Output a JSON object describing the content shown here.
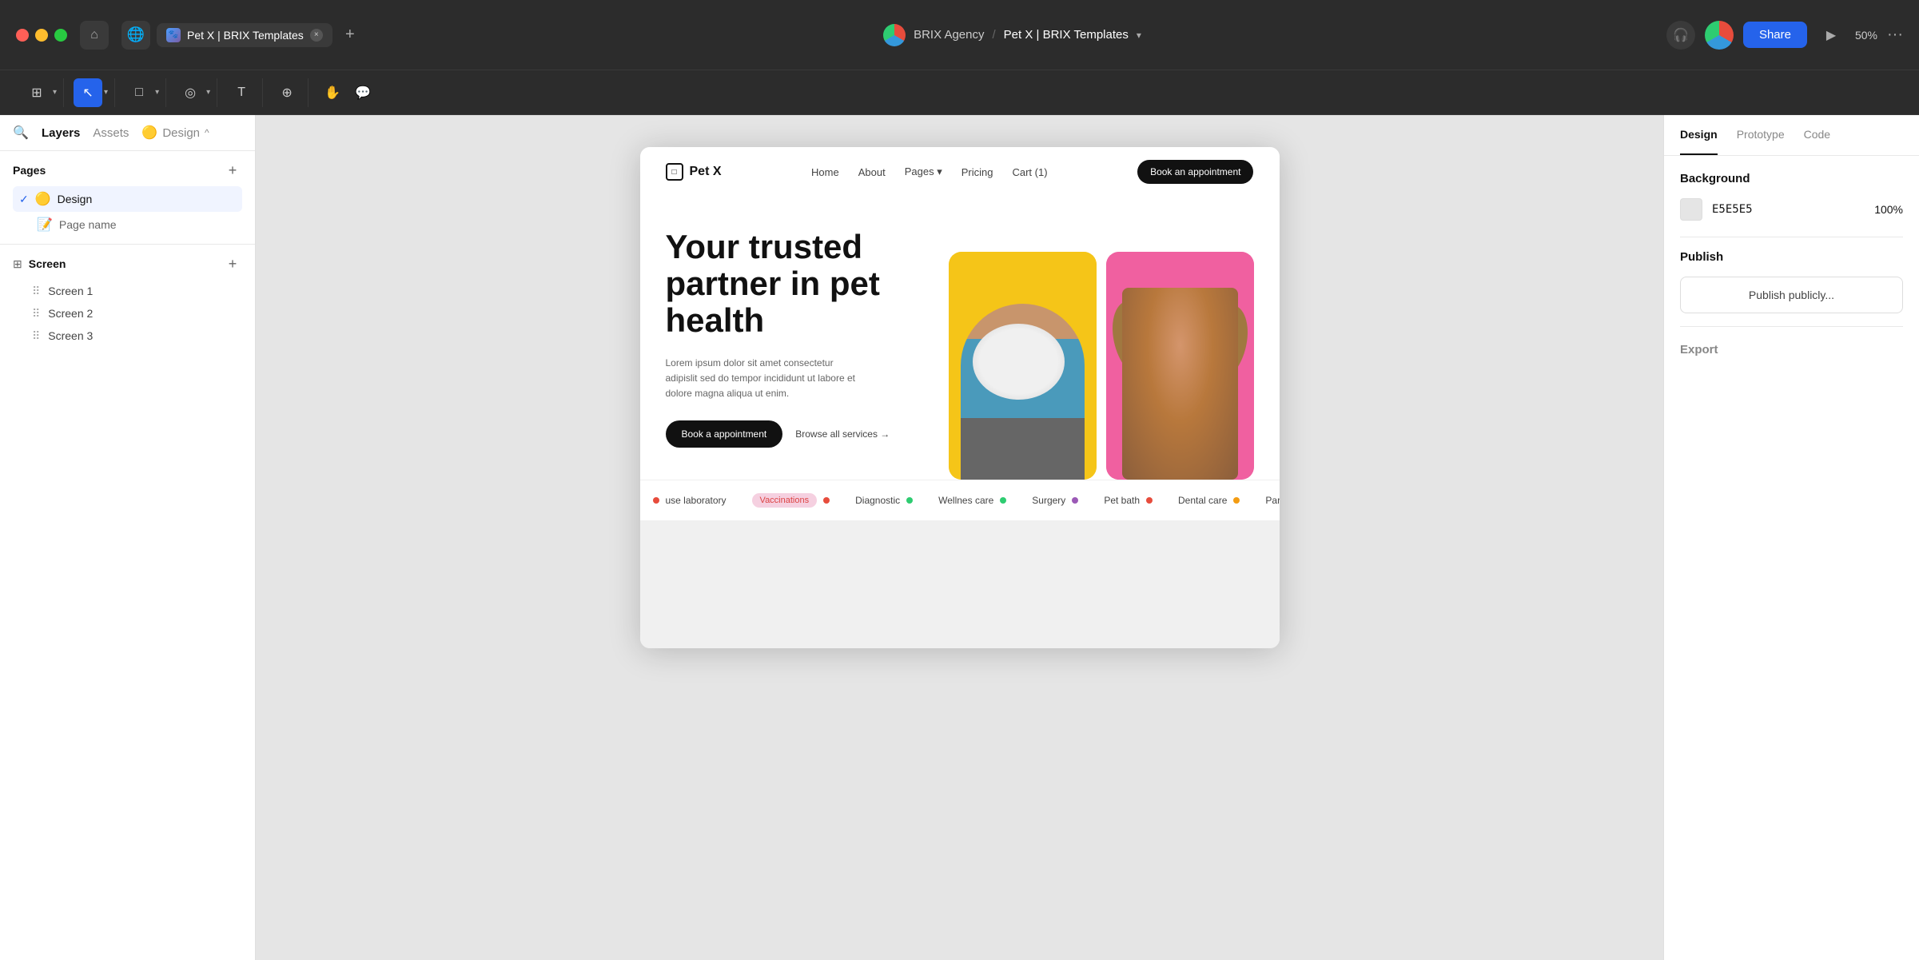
{
  "titleBar": {
    "tabLabel": "Pet X | BRIX Templates",
    "closeLabel": "×",
    "addTabLabel": "+",
    "brandName": "BRIX Agency",
    "separator": "/",
    "projectName": "Pet X | BRIX Templates",
    "shareLabel": "Share",
    "zoom": "50%",
    "dotsLabel": "···"
  },
  "toolbar": {
    "tools": [
      {
        "id": "grid",
        "symbol": "⊞",
        "active": false
      },
      {
        "id": "select",
        "symbol": "↖",
        "active": true
      },
      {
        "id": "frame",
        "symbol": "□",
        "active": false
      },
      {
        "id": "shape",
        "symbol": "◎",
        "active": false
      },
      {
        "id": "text",
        "symbol": "T",
        "active": false
      },
      {
        "id": "components",
        "symbol": "⊕",
        "active": false
      },
      {
        "id": "hand",
        "symbol": "✋",
        "active": false
      },
      {
        "id": "comment",
        "symbol": "💬",
        "active": false
      }
    ]
  },
  "leftSidebar": {
    "tabs": {
      "layers": "Layers",
      "assets": "Assets",
      "design": "Design"
    },
    "pages": {
      "title": "Pages",
      "addLabel": "+",
      "items": [
        {
          "id": "design",
          "label": "Design",
          "emoji": "🟡",
          "active": true
        },
        {
          "id": "pagename",
          "label": "Page name",
          "emoji": "📝",
          "active": false
        }
      ]
    },
    "screens": {
      "title": "Screen",
      "addLabel": "+",
      "items": [
        {
          "id": "screen1",
          "label": "Screen 1"
        },
        {
          "id": "screen2",
          "label": "Screen 2"
        },
        {
          "id": "screen3",
          "label": "Screen 3"
        }
      ]
    }
  },
  "canvas": {
    "website": {
      "logo": "Pet X",
      "nav": {
        "links": [
          "Home",
          "About",
          "Pages ▾",
          "Pricing",
          "Cart (1)"
        ],
        "ctaButton": "Book an appointment"
      },
      "hero": {
        "title": "Your trusted partner in pet health",
        "description": "Lorem ipsum dolor sit amet consectetur adipislit sed do tempor incididunt ut labore et dolore magna aliqua ut enim.",
        "primaryBtn": "Book a appointment",
        "secondaryBtn": "Browse all services →"
      },
      "services": [
        "use laboratory",
        "Vaccinations",
        "Diagnostic",
        "Wellnes care",
        "Surgery",
        "Pet bath",
        "Dental care",
        "Parasite preve..."
      ],
      "serviceDotColors": [
        "#e74c3c",
        "#f06292",
        "#2ecc71",
        "#2ecc71",
        "#9b59b6",
        "#e74c3c",
        "#f39c12",
        "#9b59b6"
      ]
    }
  },
  "rightSidebar": {
    "tabs": [
      "Design",
      "Prototype",
      "Code"
    ],
    "activeTab": "Design",
    "background": {
      "title": "Background",
      "color": "E5E5E5",
      "opacity": "100%"
    },
    "publish": {
      "title": "Publish",
      "buttonLabel": "Publish publicly..."
    },
    "export": {
      "title": "Export"
    }
  }
}
